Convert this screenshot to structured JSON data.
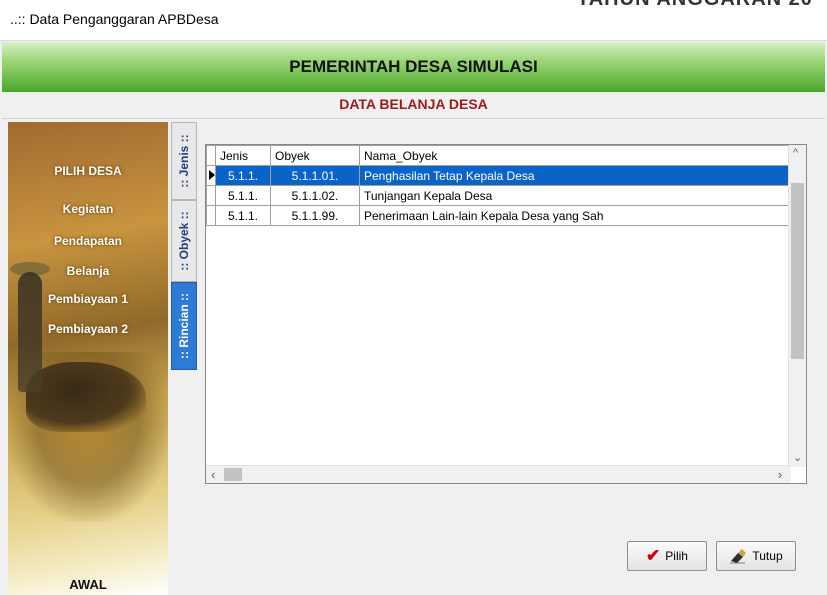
{
  "window": {
    "title": "..:: Data Penganggaran APBDesa",
    "behind_text": "TAHUN ANGGARAN 20"
  },
  "banner": {
    "title": "PEMERINTAH DESA SIMULASI"
  },
  "subheader": {
    "title": "DATA BELANJA DESA"
  },
  "colors": {
    "banner_green": "#4aa62a",
    "subheader_red": "#9b1b1b",
    "selection": "#0a64c8",
    "active_tab": "#2e7bd6"
  },
  "sidebar": {
    "items": [
      {
        "label": "PILIH DESA"
      },
      {
        "label": "Kegiatan"
      },
      {
        "label": "Pendapatan"
      },
      {
        "label": "Belanja"
      },
      {
        "label": "Pembiayaan 1"
      },
      {
        "label": "Pembiayaan 2"
      }
    ],
    "footer": "AWAL"
  },
  "tabs": [
    {
      "label": ":: Jenis ::"
    },
    {
      "label": ":: Obyek ::"
    },
    {
      "label": ":: Rincian ::",
      "active": true
    }
  ],
  "grid": {
    "columns": [
      "Jenis",
      "Obyek",
      "Nama_Obyek"
    ],
    "rows": [
      [
        "5.1.1.",
        "5.1.1.01.",
        "Penghasilan Tetap Kepala Desa"
      ],
      [
        "5.1.1.",
        "5.1.1.02.",
        "Tunjangan Kepala Desa"
      ],
      [
        "5.1.1.",
        "5.1.1.99.",
        "Penerimaan Lain-lain Kepala Desa yang Sah"
      ]
    ],
    "selected_row": 0
  },
  "buttons": {
    "pilih": "Pilih",
    "tutup": "Tutup"
  },
  "icons": {
    "check": "check-icon",
    "eraser": "eraser-icon",
    "row_indicator": "triangle-right-icon"
  }
}
